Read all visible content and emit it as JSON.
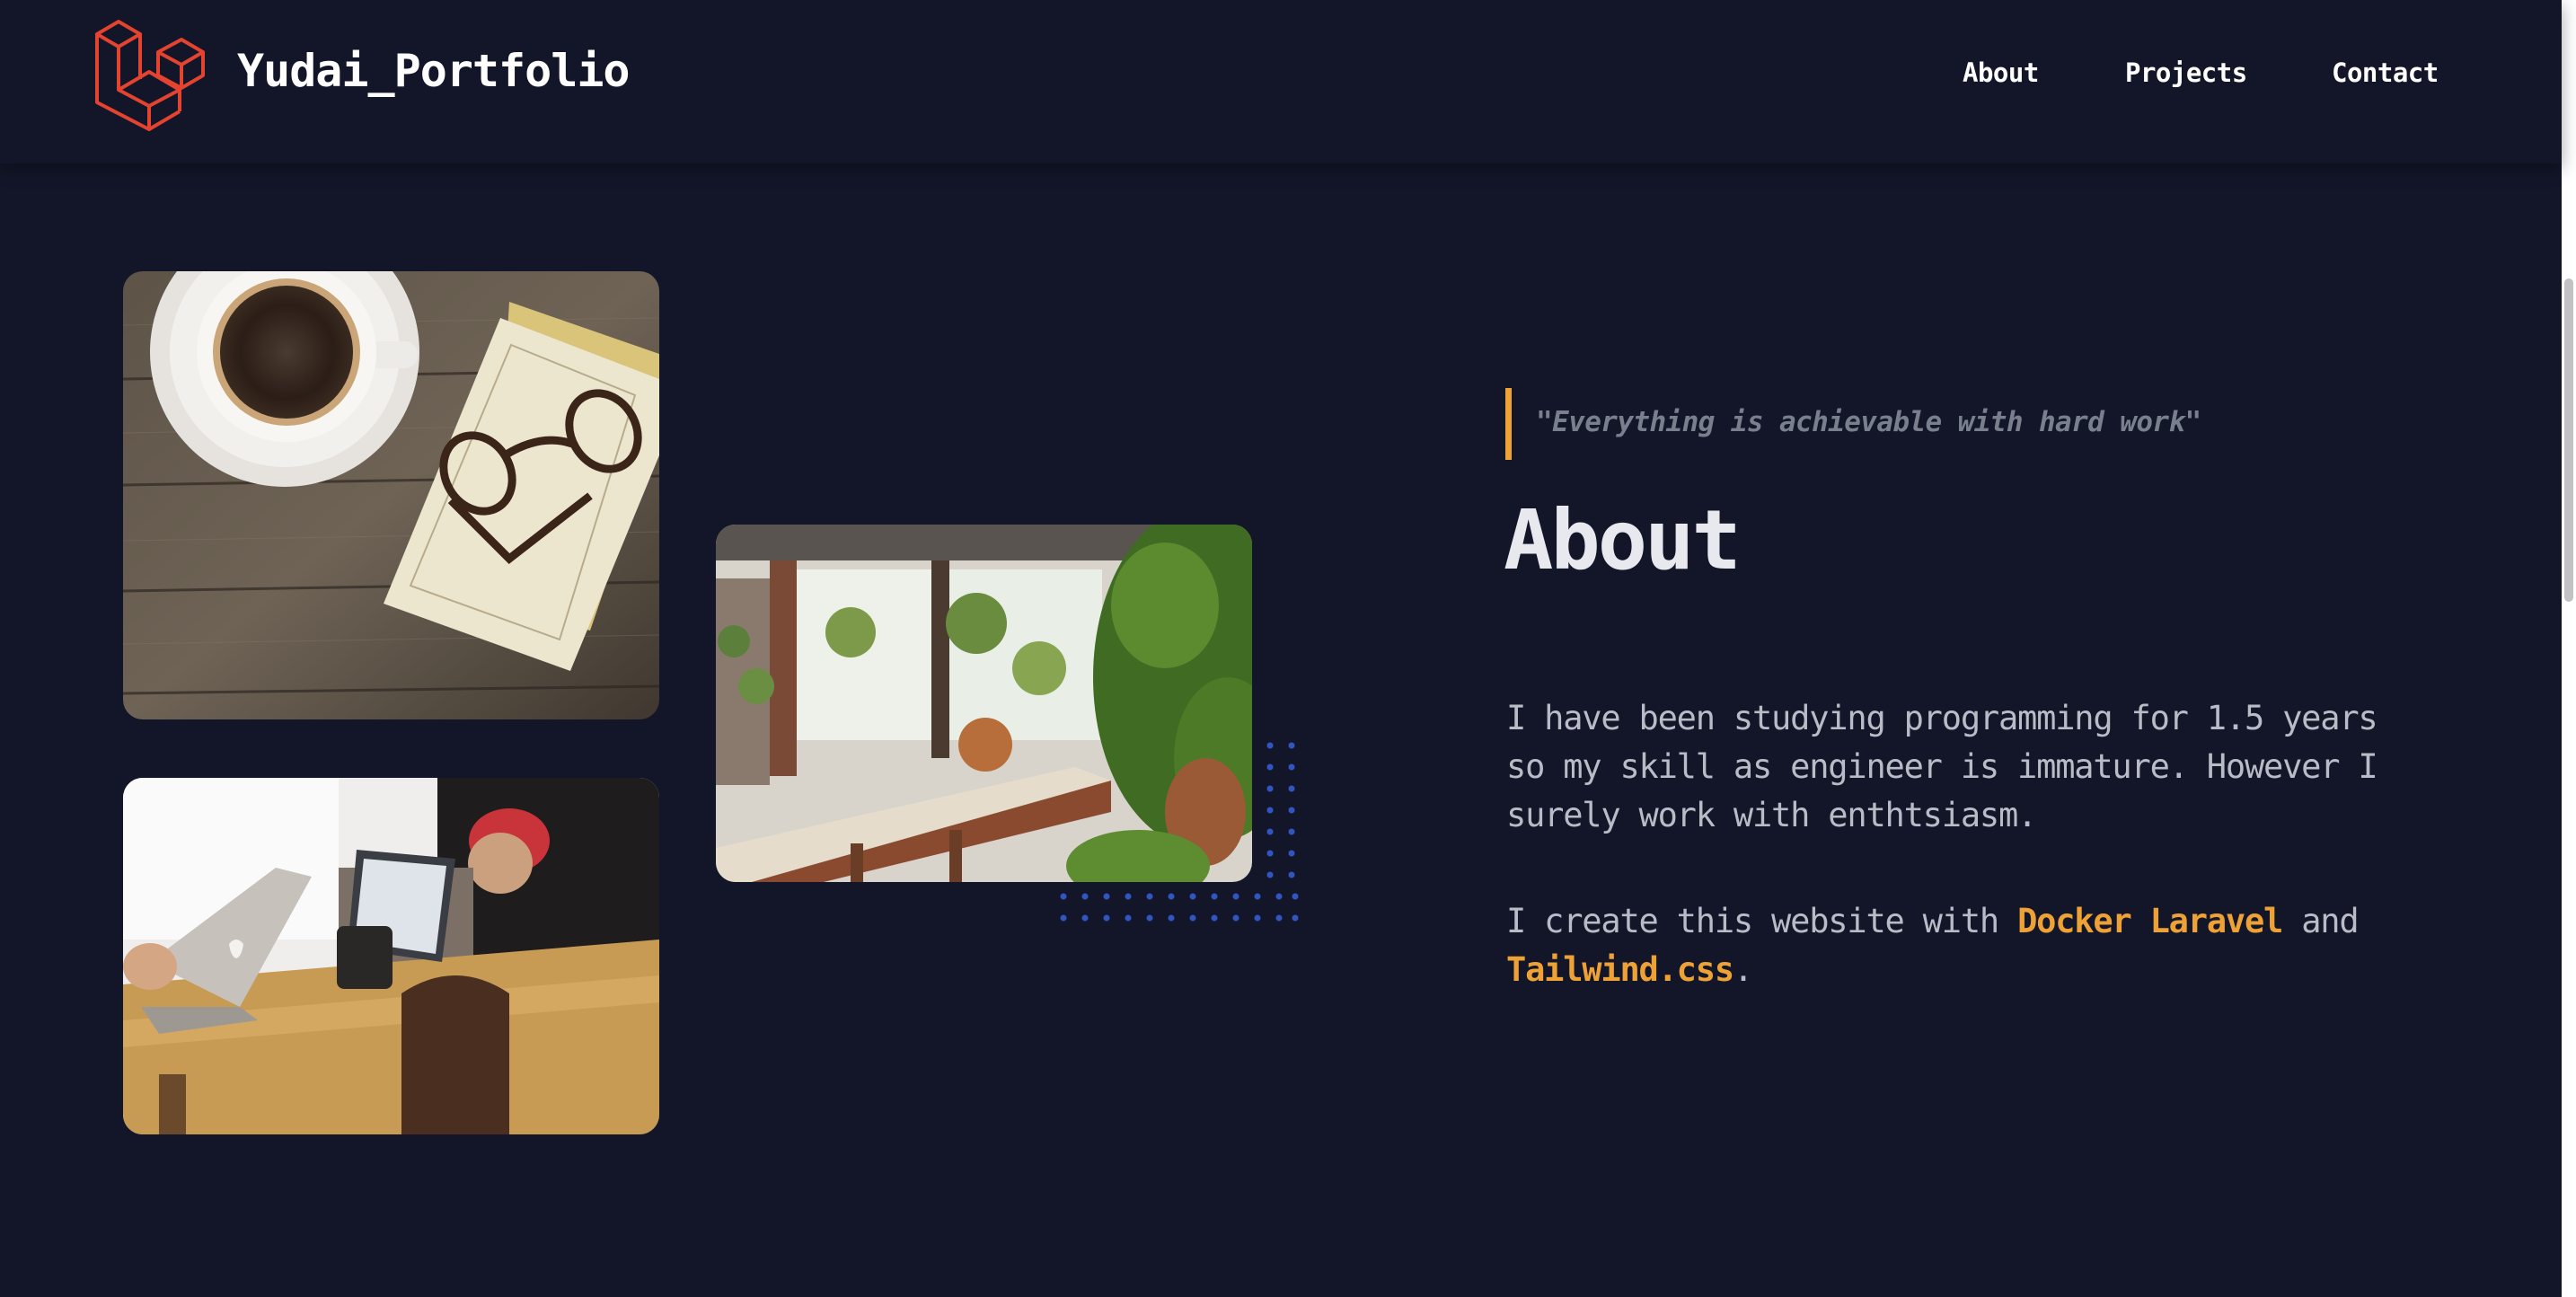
{
  "header": {
    "brand": "Yudai_Portfolio",
    "logo_icon": "laravel-logo-icon",
    "nav": [
      {
        "label": "About"
      },
      {
        "label": "Projects"
      },
      {
        "label": "Contact"
      }
    ]
  },
  "photos": [
    {
      "name": "coffee-cup-glasses-photo"
    },
    {
      "name": "people-with-laptops-photo"
    },
    {
      "name": "cafe-interior-plants-photo"
    }
  ],
  "about": {
    "quote": "\"Everything is achievable with hard work\"",
    "heading": "About",
    "paragraph1": "I have been studying programming for 1.5 years so my skill as engineer is immature. However I surely work with enthtsiasm.",
    "paragraph2_prefix": "I create this website with ",
    "paragraph2_highlight1": "Docker Laravel",
    "paragraph2_middle": " and ",
    "paragraph2_highlight2": "Tailwind.css",
    "paragraph2_suffix": "."
  },
  "colors": {
    "background": "#121628",
    "accent": "#eea236",
    "logo": "#e3432f",
    "dots": "#3355c4"
  }
}
